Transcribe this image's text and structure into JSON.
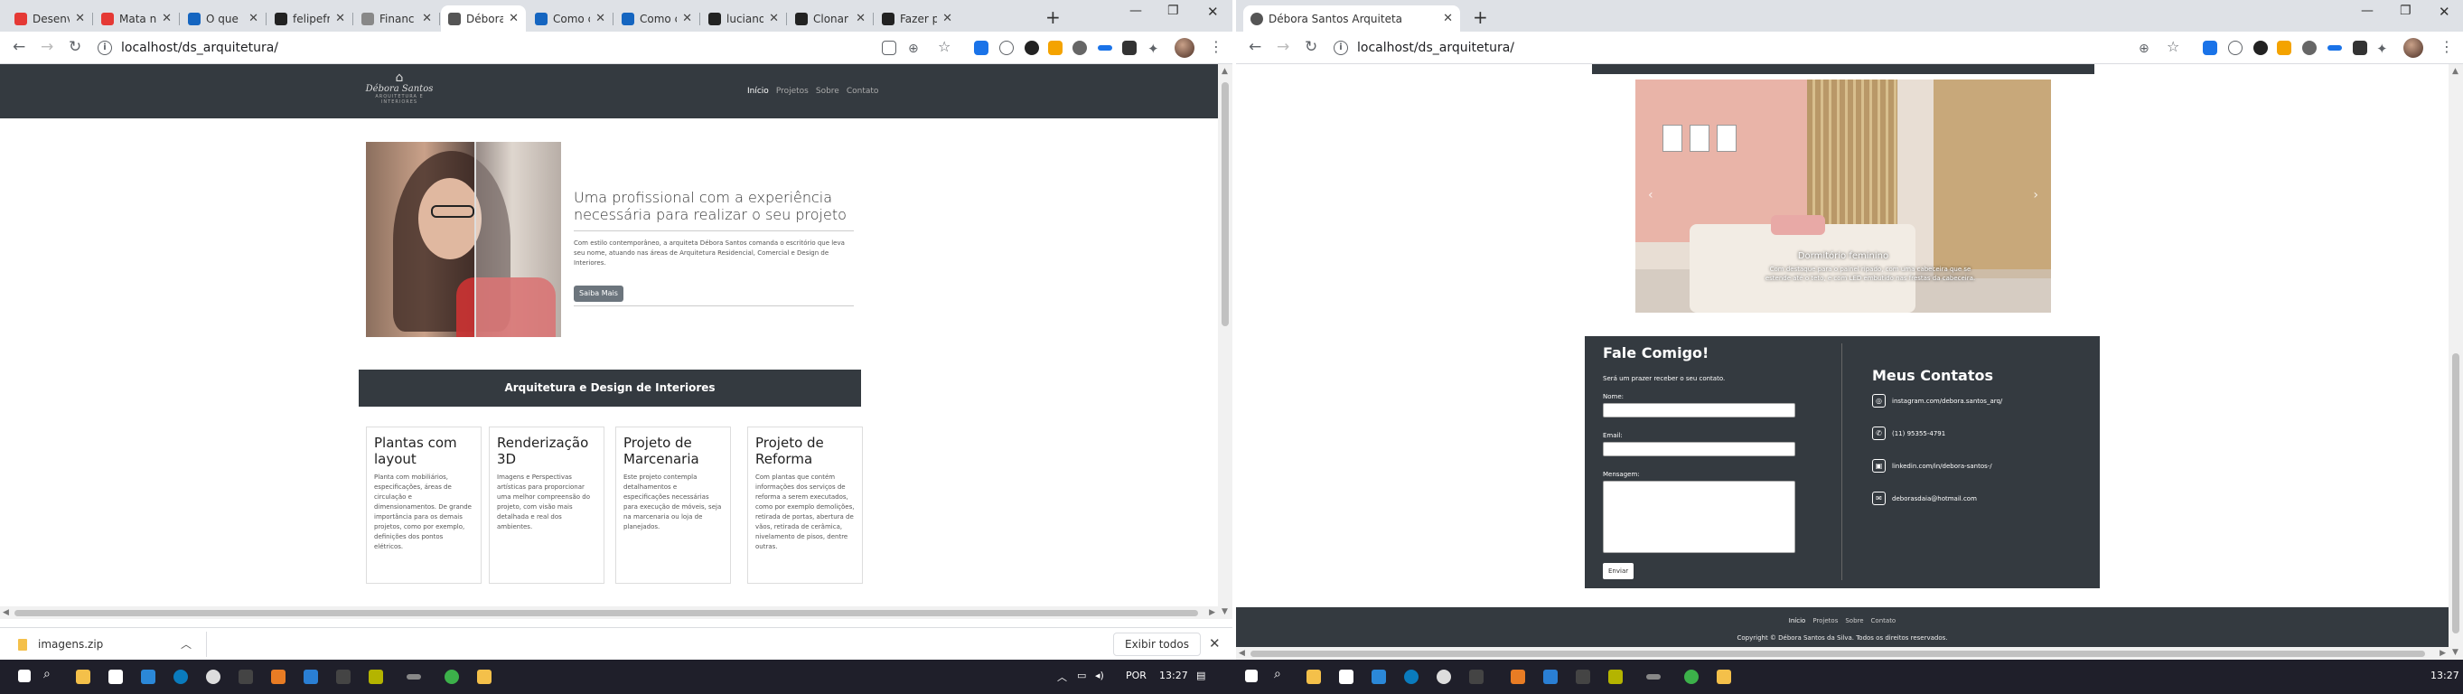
{
  "left_window": {
    "tabs": [
      {
        "title": "Desenv",
        "icon": "pdf-icon",
        "color": "#e53935"
      },
      {
        "title": "Mata n",
        "icon": "blog-icon",
        "color": "#e53935"
      },
      {
        "title": "O que",
        "icon": "ff-icon",
        "color": "#1565c0"
      },
      {
        "title": "felipefr",
        "icon": "github-icon",
        "color": "#222222"
      },
      {
        "title": "Financ",
        "icon": "doc-icon",
        "color": "#888888"
      },
      {
        "title": "Débora",
        "icon": "globe-icon",
        "color": "#555555",
        "active": true
      },
      {
        "title": "Como c",
        "icon": "ff-icon",
        "color": "#1565c0"
      },
      {
        "title": "Como c",
        "icon": "ff-icon",
        "color": "#1565c0"
      },
      {
        "title": "luciano",
        "icon": "github-icon",
        "color": "#222222"
      },
      {
        "title": "Clonar",
        "icon": "github-icon",
        "color": "#222222"
      },
      {
        "title": "Fazer p",
        "icon": "github-icon",
        "color": "#222222"
      }
    ],
    "url": "localhost/ds_arquitetura/",
    "site": {
      "logo_name": "Débora Santos",
      "logo_sub": "ARQUITETURA E INTERIORES",
      "menu": [
        "Início",
        "Projetos",
        "Sobre",
        "Contato"
      ],
      "about_title": "Uma profissional com a experiência necessária para realizar o seu projeto",
      "about_text": "Com estilo contemporâneo, a arquiteta Débora Santos comanda o escritório que leva seu nome, atuando nas áreas de Arquitetura Residencial, Comercial e Design de Interiores.",
      "about_button": "Saiba Mais",
      "banner": "Arquitetura e Design de Interiores",
      "cards": [
        {
          "title": "Plantas com layout",
          "text": "Planta com mobiliários, especificações, áreas de circulação e dimensionamentos. De grande importância para os demais projetos, como por exemplo, definições dos pontos elétricos."
        },
        {
          "title": "Renderização 3D",
          "text": "Imagens e Perspectivas artísticas para proporcionar uma melhor compreensão do projeto, com visão mais detalhada e real dos ambientes."
        },
        {
          "title": "Projeto de Marcenaria",
          "text": "Este projeto contempla detalhamentos e especificações necessárias para execução de móveis, seja na marcenaria ou loja de planejados."
        },
        {
          "title": "Projeto de Reforma",
          "text": "Com plantas que contém informações dos serviços de reforma a serem executados, como por exemplo demolições, retirada de portas, abertura de vãos, retirada de cerâmica, nivelamento de pisos, dentre outras."
        }
      ]
    },
    "download": {
      "file": "imagens.zip",
      "show_all": "Exibir todos"
    }
  },
  "right_window": {
    "tab_title": "Débora Santos Arquiteta",
    "url": "localhost/ds_arquitetura/",
    "site": {
      "carousel_caption_title": "Dormitório feminino",
      "carousel_caption_text": "Com destaque para o painel ripado, com uma cabeceira que se estende até o teto, e com LED embutido nas frestas da cabeceira.",
      "contact_title": "Fale Comigo!",
      "contact_sub": "Será um prazer receber o seu contato.",
      "label_name": "Nome:",
      "label_email": "Email:",
      "label_message": "Mensagem:",
      "send_button": "Enviar",
      "contacts_title": "Meus Contatos",
      "contacts": [
        {
          "icon": "instagram-icon",
          "text": "instagram.com/debora.santos_arq/"
        },
        {
          "icon": "whatsapp-icon",
          "text": "(11) 95355-4791"
        },
        {
          "icon": "linkedin-icon",
          "text": "linkedin.com/in/debora-santos-/"
        },
        {
          "icon": "email-icon",
          "text": "deborasdaia@hotmail.com"
        }
      ],
      "footer_menu": [
        "Início",
        "Projetos",
        "Sobre",
        "Contato"
      ],
      "copyright": "Copyright © Débora Santos da Silva. Todos os direitos reservados."
    }
  },
  "taskbar": {
    "lang": "POR",
    "time_left": "13:27",
    "time_right": "13:27"
  }
}
